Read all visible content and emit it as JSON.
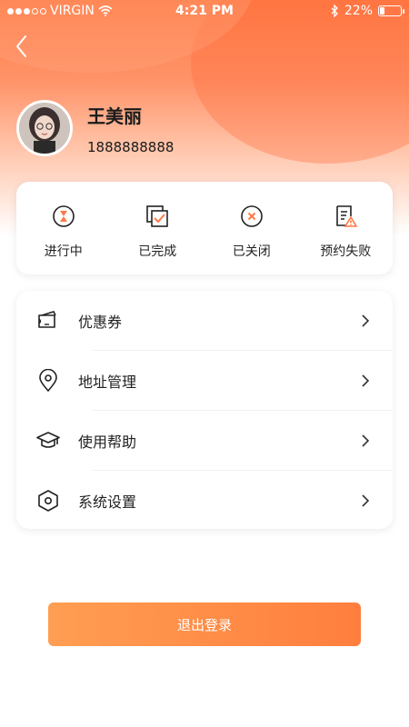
{
  "status_bar": {
    "carrier": "VIRGIN",
    "time": "4:21 PM",
    "battery_percent": "22%",
    "battery_level": 0.22
  },
  "profile": {
    "name": "王美丽",
    "phone": "1888888888"
  },
  "orders": [
    {
      "label": "进行中",
      "icon": "hourglass-icon"
    },
    {
      "label": "已完成",
      "icon": "completed-check-icon"
    },
    {
      "label": "已关闭",
      "icon": "closed-x-icon"
    },
    {
      "label": "预约失败",
      "icon": "failed-warning-icon"
    }
  ],
  "menu": [
    {
      "label": "优惠券",
      "icon": "coupon-icon"
    },
    {
      "label": "地址管理",
      "icon": "location-pin-icon"
    },
    {
      "label": "使用帮助",
      "icon": "graduation-cap-icon"
    },
    {
      "label": "系统设置",
      "icon": "settings-hexagon-icon"
    }
  ],
  "logout_label": "退出登录",
  "colors": {
    "accent": "#ff7a45",
    "button_start": "#ff9e52",
    "button_end": "#ff7e3e"
  }
}
